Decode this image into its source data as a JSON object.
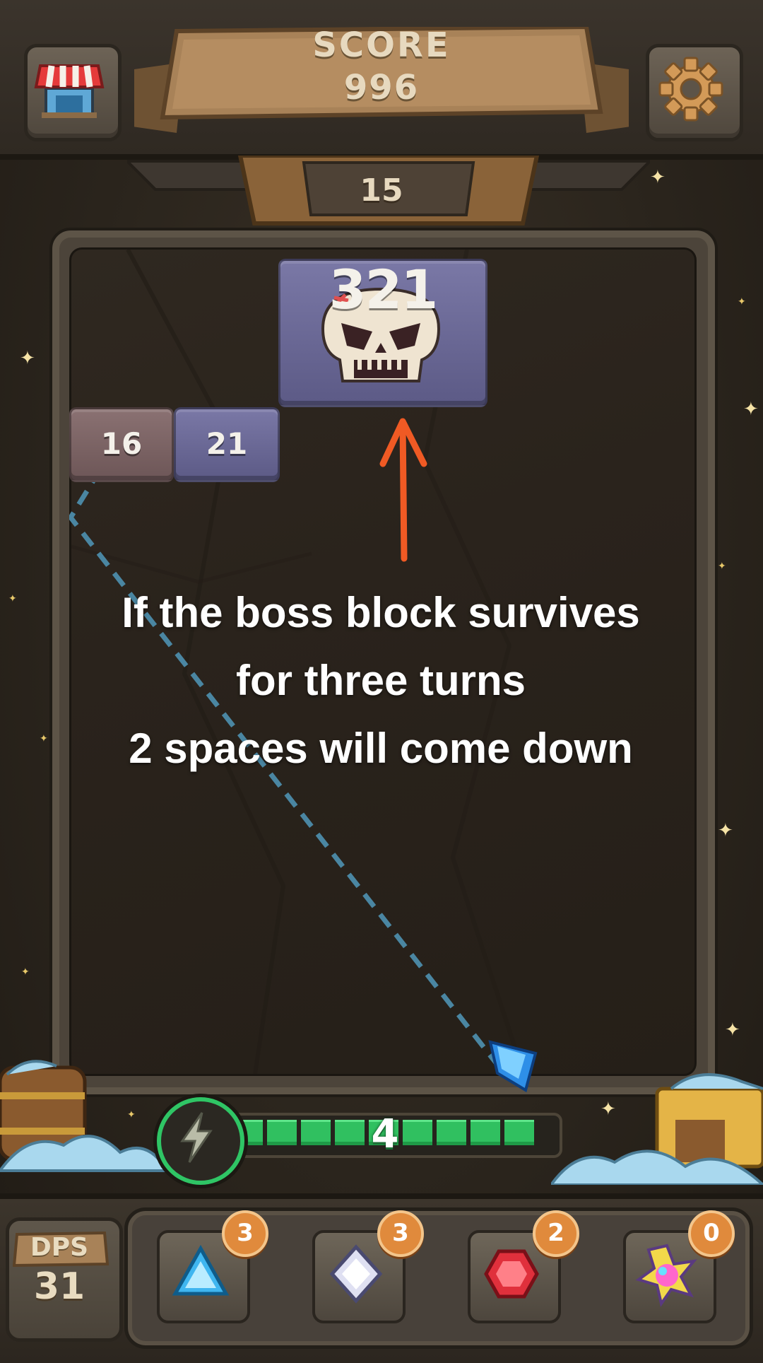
{
  "header": {
    "score_label": "SCORE",
    "score_value": "996",
    "shop_icon": "shop-stall-icon",
    "settings_icon": "gear-icon"
  },
  "turn": {
    "value": "15"
  },
  "blocks": {
    "boss": {
      "value": "321",
      "icon": "angry-skull-icon"
    },
    "block_a": {
      "value": "16"
    },
    "block_b": {
      "value": "21"
    }
  },
  "tutorial": {
    "line1": "If the boss block survives",
    "line2": "for three turns",
    "line3": "2 spaces will come down",
    "arrow_color": "#f05a24"
  },
  "launcher": {
    "icon": "blue-crystal-icon",
    "aim_line_color": "#4a86a2"
  },
  "energy": {
    "value": "4",
    "icon": "lightning-bolt-icon",
    "bar_color": "#30c060"
  },
  "footer": {
    "dps_label": "DPS",
    "dps_value": "31",
    "gems": [
      {
        "icon": "blue-triangle-gem-icon",
        "count": "3"
      },
      {
        "icon": "white-diamond-gem-icon",
        "count": "3"
      },
      {
        "icon": "red-hexagon-gem-icon",
        "count": "2"
      },
      {
        "icon": "rainbow-star-gem-icon",
        "count": "0"
      }
    ],
    "badge_color": "#e08a3c"
  }
}
